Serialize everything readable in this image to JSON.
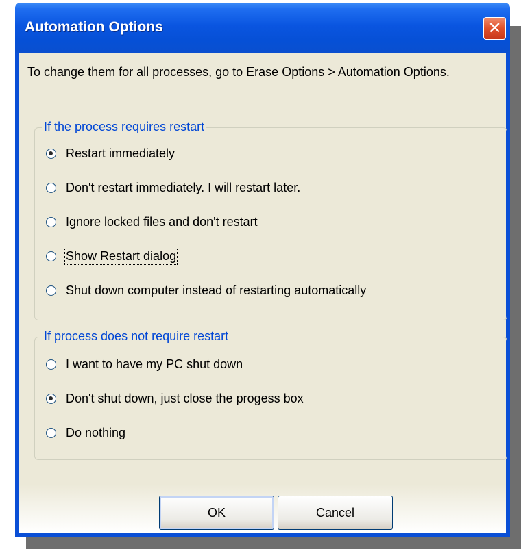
{
  "window": {
    "title": "Automation Options",
    "close_glyph": "✕"
  },
  "instruction": "To change them for all processes, go to Erase Options > Automation Options.",
  "group_restart": {
    "label": "If the process requires restart",
    "options": [
      {
        "label": "Restart immediately",
        "checked": true
      },
      {
        "label": "Don't restart immediately. I will restart later.",
        "checked": false
      },
      {
        "label": "Ignore locked files and don't restart",
        "checked": false
      },
      {
        "label": "Show Restart dialog",
        "checked": false,
        "focused": true
      },
      {
        "label": "Shut down computer instead of restarting automatically",
        "checked": false
      }
    ]
  },
  "group_no_restart": {
    "label": "If process does not require restart",
    "options": [
      {
        "label": "I want to have my PC shut down",
        "checked": false
      },
      {
        "label": "Don't shut down, just close the progess box",
        "checked": true
      },
      {
        "label": "Do nothing",
        "checked": false
      }
    ]
  },
  "buttons": {
    "ok": "OK",
    "cancel": "Cancel"
  },
  "colors": {
    "titlebar": "#0a55e0",
    "group_label": "#0046d5",
    "dialog_bg": "#ece9d8",
    "close_button": "#e0502a"
  }
}
